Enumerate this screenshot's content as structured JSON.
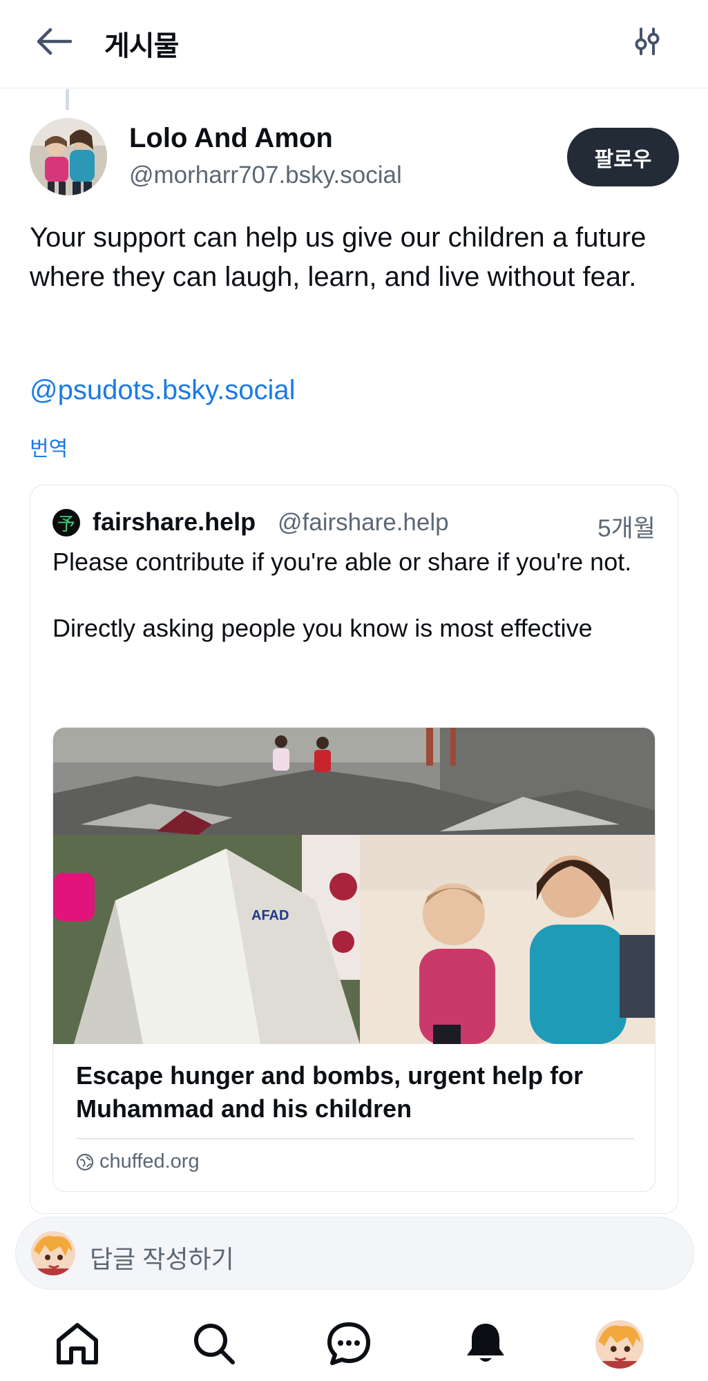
{
  "header": {
    "title": "게시물",
    "back_icon": "arrow-left-icon",
    "filter_icon": "sliders-icon"
  },
  "post": {
    "author_name": "Lolo And Amon",
    "author_handle": "@morharr707.bsky.social",
    "follow_label": "팔로우",
    "text": "Your support can help us give our children a future where they can laugh, learn, and live without fear.",
    "mention": "@psudots.bsky.social",
    "translate_label": "번역"
  },
  "quote": {
    "author_name": "fairshare.help",
    "author_handle": "@fairshare.help",
    "time": "5개월",
    "avatar_glyph": "予",
    "text": "Please contribute if you're able or share if you're not.\n\nDirectly asking people you know is most effective",
    "link": {
      "image_text": "AFAD",
      "title": "Escape hunger and bombs, urgent help for Muhammad and his children",
      "domain": "chuffed.org"
    }
  },
  "reply": {
    "placeholder": "답글 작성하기"
  },
  "nav": {
    "items": [
      "home-icon",
      "search-icon",
      "chat-icon",
      "notifications-icon",
      "profile-avatar"
    ]
  },
  "colors": {
    "accent": "#1a7ae8",
    "follow_bg": "#222b36",
    "muted": "#5b6773",
    "border": "#e2e7ec"
  }
}
